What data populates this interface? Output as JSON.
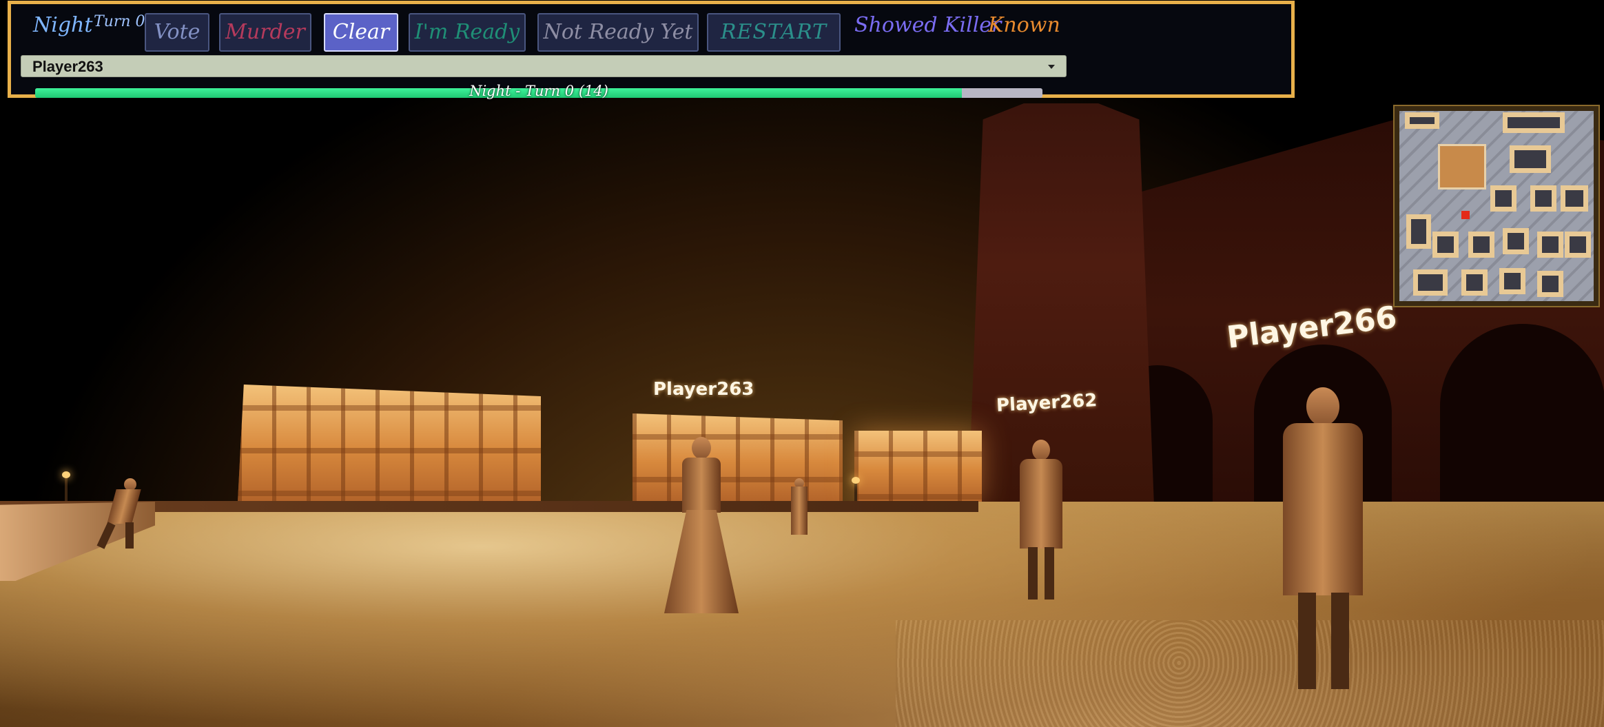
{
  "hud": {
    "phase": "Night",
    "turn": "Turn 0",
    "buttons": {
      "vote": "Vote",
      "murder": "Murder",
      "clear": "Clear",
      "ready": "I'm Ready",
      "not_ready": "Not Ready Yet",
      "restart": "RESTART"
    },
    "status_showed_killer": "Showed Killer",
    "status_known": "Known",
    "player_select": {
      "selected": "Player263"
    },
    "progress": {
      "label": "Night - Turn 0 (14)",
      "fraction": 0.92
    }
  },
  "scene": {
    "name_tags": [
      "Player263",
      "Player262",
      "Player266"
    ]
  },
  "colors": {
    "hud_border": "#e8b04a",
    "clear_active": "#5b62c7",
    "progress_fill": "#3ef29a",
    "minimap_player": "#e42a18"
  }
}
